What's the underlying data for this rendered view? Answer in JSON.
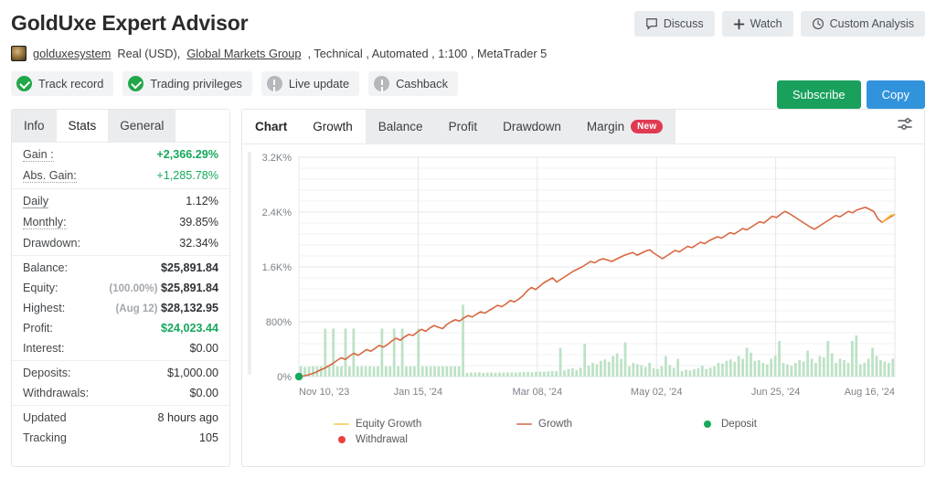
{
  "header": {
    "title": "GoldUxe Expert Advisor",
    "actions": [
      {
        "label": "Discuss",
        "icon": "chat-icon"
      },
      {
        "label": "Watch",
        "icon": "plus-icon"
      },
      {
        "label": "Custom Analysis",
        "icon": "clock-icon"
      }
    ],
    "subtitle": {
      "account": "golduxesystem",
      "type": "Real (USD),",
      "broker": "Global Markets Group",
      "rest": ", Technical , Automated , 1:100 , MetaTrader 5"
    },
    "badges": [
      {
        "label": "Track record",
        "state": "ok"
      },
      {
        "label": "Trading privileges",
        "state": "ok"
      },
      {
        "label": "Live update",
        "state": "off"
      },
      {
        "label": "Cashback",
        "state": "off"
      }
    ],
    "cta": {
      "subscribe": "Subscribe",
      "copy": "Copy"
    },
    "colors": {
      "green": "#18a05c",
      "blue": "#3293dd",
      "badge_ok": "#20a74a",
      "badge_off": "#b4b7bb"
    }
  },
  "sidebar": {
    "tabs": [
      {
        "label": "Info",
        "active": false
      },
      {
        "label": "Stats",
        "active": true
      },
      {
        "label": "General",
        "active": false
      }
    ],
    "groups": [
      {
        "rows": [
          {
            "label": "Gain :",
            "value": "+2,366.29%",
            "style": "green",
            "underline": "dotted"
          },
          {
            "label": "Abs. Gain:",
            "value": "+1,285.78%",
            "style": "green-n",
            "underline": "dotted"
          }
        ]
      },
      {
        "rows": [
          {
            "label": "Daily",
            "value": "1.12%",
            "style": "",
            "underline": "solid"
          },
          {
            "label": "Monthly:",
            "value": "39.85%",
            "style": "",
            "underline": "dotted"
          },
          {
            "label": "Drawdown:",
            "value": "32.34%",
            "style": "",
            "underline": "none"
          }
        ]
      },
      {
        "rows": [
          {
            "label": "Balance:",
            "value": "$25,891.84",
            "style": "bold",
            "underline": "none"
          },
          {
            "label": "Equity:",
            "value": "$25,891.84",
            "prefix": "(100.00%)",
            "style": "bold",
            "underline": "none"
          },
          {
            "label": "Highest:",
            "value": "$28,132.95",
            "prefix": "(Aug 12)",
            "style": "bold",
            "underline": "none"
          },
          {
            "label": "Profit:",
            "value": "$24,023.44",
            "style": "green-n",
            "underline": "none"
          },
          {
            "label": "Interest:",
            "value": "$0.00",
            "style": "",
            "underline": "none"
          }
        ]
      },
      {
        "rows": [
          {
            "label": "Deposits:",
            "value": "$1,000.00",
            "style": "",
            "underline": "none"
          },
          {
            "label": "Withdrawals:",
            "value": "$0.00",
            "style": "",
            "underline": "none"
          }
        ]
      },
      {
        "rows": [
          {
            "label": "Updated",
            "value": "8 hours ago",
            "style": "",
            "underline": "none"
          },
          {
            "label": "Tracking",
            "value": "105",
            "style": "",
            "underline": "none"
          }
        ]
      }
    ]
  },
  "chart_panel": {
    "tabs": [
      {
        "label": "Chart",
        "active": false,
        "bold": true
      },
      {
        "label": "Growth",
        "active": true,
        "bold": false
      },
      {
        "label": "Balance",
        "active": false,
        "bold": false
      },
      {
        "label": "Profit",
        "active": false,
        "bold": false
      },
      {
        "label": "Drawdown",
        "active": false,
        "bold": false
      },
      {
        "label": "Margin",
        "active": false,
        "bold": false,
        "badge": "New"
      }
    ],
    "settings_icon": "sliders-icon"
  },
  "chart_data": {
    "type": "line",
    "title": "Growth",
    "xlabel": "",
    "ylabel": "",
    "ylim": [
      0,
      3200
    ],
    "yticks": [
      0,
      800,
      1600,
      2400,
      3200
    ],
    "ytick_labels": [
      "0%",
      "800%",
      "1.6K%",
      "2.4K%",
      "3.2K%"
    ],
    "xtick_labels": [
      "Nov 10, '23",
      "Jan 15, '24",
      "Mar 08, '24",
      "May 02, '24",
      "Jun 25, '24",
      "Aug 16, '24"
    ],
    "xtick_positions": [
      0,
      0.2,
      0.4,
      0.6,
      0.8,
      1.0
    ],
    "grid": true,
    "legend_position": "bottom",
    "legend": [
      {
        "name": "Equity Growth",
        "marker": "line",
        "color": "#f5d678"
      },
      {
        "name": "Growth",
        "marker": "line",
        "color": "#e08878"
      },
      {
        "name": "Deposit",
        "marker": "dot",
        "color": "#16a85b"
      },
      {
        "name": "Withdrawal",
        "marker": "dot",
        "color": "#e8413f"
      }
    ],
    "series": [
      {
        "name": "Growth",
        "color": "#d9663f",
        "values": [
          0,
          8,
          22,
          40,
          62,
          95,
          120,
          155,
          190,
          235,
          275,
          250,
          300,
          340,
          310,
          350,
          395,
          370,
          410,
          455,
          430,
          470,
          520,
          560,
          530,
          580,
          615,
          600,
          650,
          690,
          660,
          710,
          745,
          720,
          700,
          760,
          800,
          830,
          810,
          855,
          890,
          870,
          910,
          945,
          925,
          965,
          1000,
          1040,
          1020,
          1060,
          1110,
          1090,
          1130,
          1180,
          1250,
          1300,
          1270,
          1320,
          1370,
          1405,
          1440,
          1380,
          1420,
          1460,
          1500,
          1540,
          1570,
          1600,
          1640,
          1680,
          1660,
          1700,
          1720,
          1700,
          1680,
          1710,
          1740,
          1770,
          1790,
          1810,
          1770,
          1800,
          1830,
          1850,
          1800,
          1760,
          1720,
          1760,
          1800,
          1840,
          1820,
          1860,
          1900,
          1880,
          1920,
          1960,
          1940,
          1980,
          2010,
          2040,
          2020,
          2060,
          2100,
          2080,
          2120,
          2160,
          2140,
          2180,
          2220,
          2260,
          2240,
          2290,
          2340,
          2320,
          2370,
          2410,
          2380,
          2340,
          2300,
          2260,
          2220,
          2180,
          2150,
          2190,
          2230,
          2270,
          2310,
          2350,
          2330,
          2370,
          2410,
          2390,
          2430,
          2450,
          2470,
          2440,
          2410,
          2300,
          2250,
          2290,
          2330,
          2366
        ]
      },
      {
        "name": "Equity Growth",
        "color": "#f5b942",
        "values_tail": [
          2250,
          2300,
          2350,
          2366
        ]
      }
    ],
    "deposit_markers": [
      {
        "x": 0,
        "y": 0,
        "color": "#16a85b"
      }
    ],
    "bars": {
      "name": "Volume",
      "color": "#b9e0c2",
      "values": [
        150,
        140,
        145,
        150,
        148,
        150,
        700,
        150,
        700,
        150,
        150,
        700,
        150,
        700,
        148,
        150,
        150,
        150,
        145,
        150,
        700,
        150,
        150,
        700,
        150,
        700,
        148,
        150,
        150,
        700,
        150,
        150,
        150,
        150,
        148,
        150,
        150,
        150,
        150,
        150,
        1050,
        55,
        60,
        58,
        62,
        55,
        58,
        60,
        56,
        60,
        58,
        62,
        60,
        58,
        65,
        70,
        68,
        65,
        70,
        72,
        70,
        75,
        80,
        78,
        420,
        90,
        110,
        120,
        95,
        130,
        480,
        160,
        200,
        180,
        230,
        250,
        215,
        300,
        340,
        260,
        500,
        150,
        200,
        180,
        165,
        140,
        200,
        120,
        110,
        150,
        300,
        170,
        130,
        260,
        80,
        100,
        90,
        110,
        120,
        160,
        110,
        130,
        150,
        200,
        190,
        230,
        250,
        215,
        300,
        260,
        420,
        350,
        230,
        240,
        200,
        180,
        260,
        300,
        520,
        200,
        180,
        160,
        200,
        240,
        220,
        380,
        260,
        200,
        300,
        280,
        520,
        340,
        200,
        260,
        240,
        200,
        520,
        600,
        180,
        200,
        260,
        420,
        300,
        240,
        220,
        200,
        260
      ]
    }
  }
}
